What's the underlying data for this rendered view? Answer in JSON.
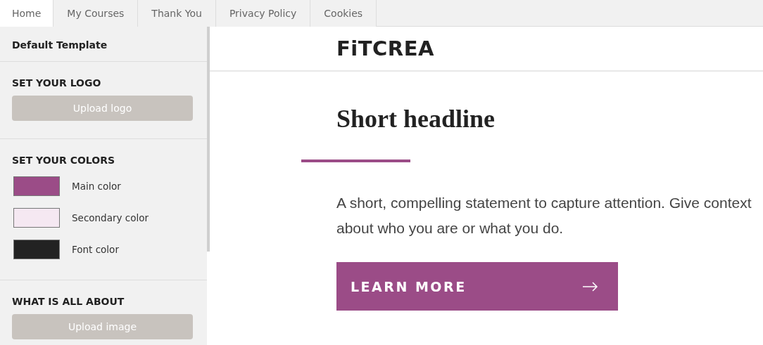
{
  "tabs": [
    {
      "label": "Home",
      "selected": true
    },
    {
      "label": "My Courses",
      "selected": false
    },
    {
      "label": "Thank You",
      "selected": false
    },
    {
      "label": "Privacy Policy",
      "selected": false
    },
    {
      "label": "Cookies",
      "selected": false
    }
  ],
  "sidebar": {
    "title": "Default Template",
    "logo_section": {
      "heading": "SET YOUR LOGO",
      "button": "Upload logo"
    },
    "colors_section": {
      "heading": "SET YOUR COLORS",
      "colors": [
        {
          "label": "Main color",
          "color": "#9b4c87"
        },
        {
          "label": "Secondary color",
          "color": "#f5e8f2"
        },
        {
          "label": "Font color",
          "color": "#222222"
        }
      ]
    },
    "about_section": {
      "heading": "WHAT IS ALL ABOUT",
      "button": "Upload image"
    }
  },
  "preview": {
    "logo": "FiTCREA",
    "headline": "Short headline",
    "statement": "A short, compelling statement to capture attention. Give context about who you are or what you do.",
    "button": "LEARN MORE"
  }
}
